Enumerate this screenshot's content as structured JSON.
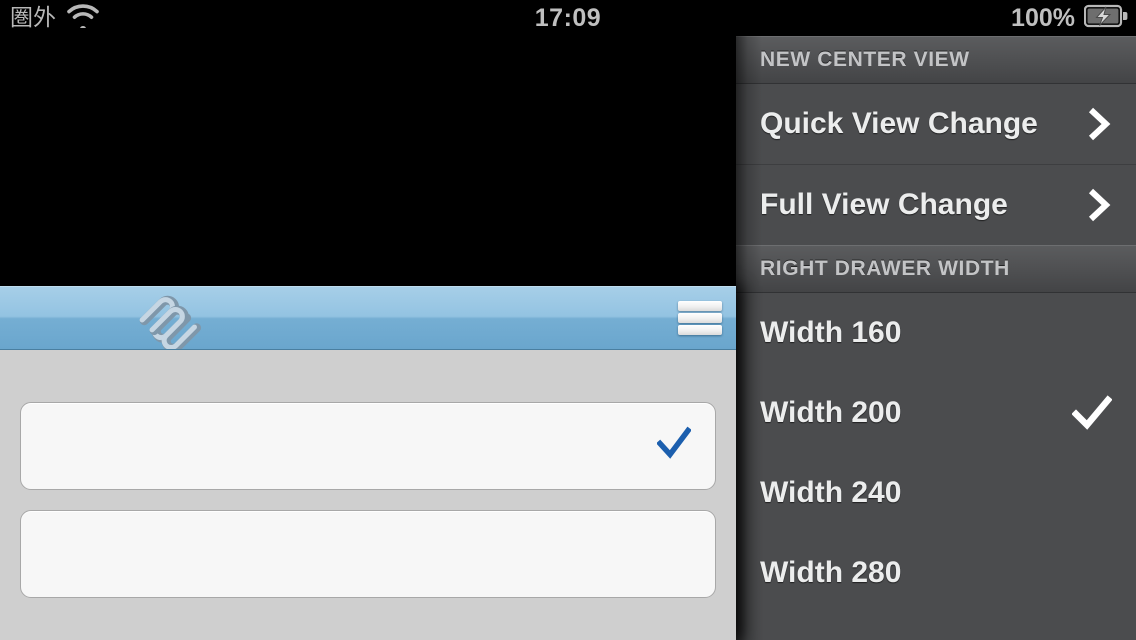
{
  "status_bar": {
    "carrier": "圏外",
    "wifi_icon": "wifi-icon",
    "time": "17:09",
    "battery_percent": "100%",
    "battery_icon": "battery-charging-icon"
  },
  "center_panel": {
    "navbar": {
      "logo_icon": "squarespace-logo-icon",
      "menu_icon": "hamburger-menu-icon"
    },
    "cells": [
      {
        "name": "selected-cell",
        "check_icon": "blue-checkmark-icon",
        "checked": true
      },
      {
        "name": "second-cell",
        "check_icon": "",
        "checked": false
      }
    ],
    "accent_check_color": "#1c5fae",
    "navbar_color": "#8dc0e0",
    "body_color": "#cfcfcf"
  },
  "right_drawer": {
    "background_color": "#4b4c4e",
    "sections": [
      {
        "header": "NEW CENTER VIEW",
        "rows": [
          {
            "label": "Quick View Change",
            "accessory": "chevron-right-icon"
          },
          {
            "label": "Full View Change",
            "accessory": "chevron-right-icon"
          }
        ]
      },
      {
        "header": "RIGHT DRAWER WIDTH",
        "rows": [
          {
            "label": "Width 160",
            "accessory": ""
          },
          {
            "label": "Width 200",
            "accessory": "checkmark-icon"
          },
          {
            "label": "Width 240",
            "accessory": ""
          },
          {
            "label": "Width 280",
            "accessory": ""
          }
        ]
      }
    ]
  }
}
